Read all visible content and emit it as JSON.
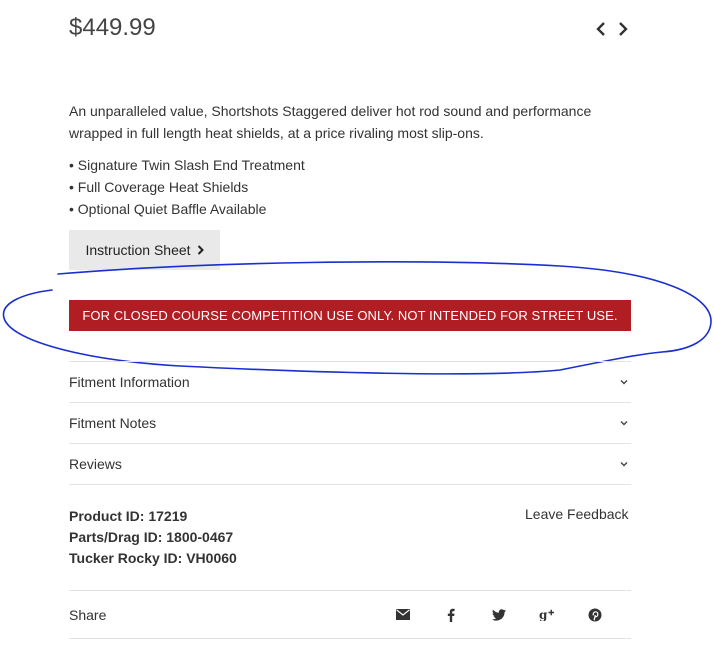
{
  "product": {
    "price": "$449.99",
    "description": "An unparalleled value, Shortshots Staggered deliver hot rod sound and performance wrapped in full length heat shields, at a price rivaling most slip-ons.",
    "features": [
      "• Signature Twin Slash End Treatment",
      "• Full Coverage Heat Shields",
      "• Optional Quiet Baffle Available"
    ],
    "instruction_label": "Instruction Sheet",
    "warning": "FOR CLOSED COURSE COMPETITION USE ONLY. NOT INTENDED FOR STREET USE."
  },
  "nav": {
    "prev_icon": "chevron-left-icon",
    "next_icon": "chevron-right-icon"
  },
  "accordion": [
    {
      "label": "Fitment Information",
      "icon": "chevron-down-icon"
    },
    {
      "label": "Fitment Notes",
      "icon": "chevron-down-icon"
    },
    {
      "label": "Reviews",
      "icon": "chevron-down-icon"
    }
  ],
  "ids": {
    "product_id": "Product ID: 17219",
    "parts_drag_id": "Parts/Drag ID: 1800-0467",
    "tucker_rocky_id": "Tucker Rocky ID: VH0060"
  },
  "feedback_label": "Leave Feedback",
  "share": {
    "label": "Share",
    "icons": [
      "envelope-icon",
      "facebook-icon",
      "twitter-icon",
      "google-plus-icon",
      "pinterest-icon"
    ]
  },
  "colors": {
    "warning_bg": "#b01e23",
    "annotation_stroke": "#1a2fd0",
    "button_bg": "#e9e9e9"
  }
}
